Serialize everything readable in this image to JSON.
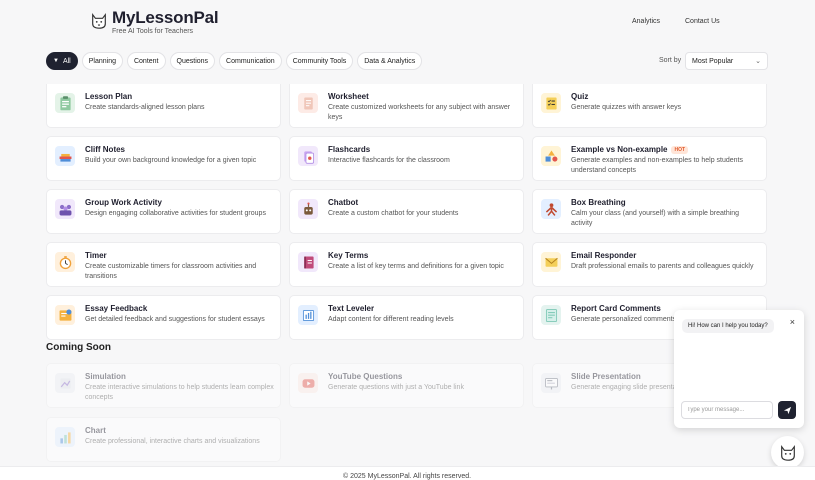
{
  "header": {
    "brand": "MyLessonPal",
    "tagline": "Free AI Tools for Teachers",
    "logo_icon": "cat-face-icon",
    "nav": {
      "analytics": "Analytics",
      "contact": "Contact Us"
    }
  },
  "filters": [
    "All",
    "Planning",
    "Content",
    "Questions",
    "Communication",
    "Community Tools",
    "Data & Analytics"
  ],
  "sort": {
    "label": "Sort by",
    "value": "Most Popular"
  },
  "tools": [
    {
      "title": "Lesson Plan",
      "desc": "Create standards-aligned lesson plans",
      "icon": "clipboard-icon",
      "color": "#e4f3e8"
    },
    {
      "title": "Worksheet",
      "desc": "Create customized worksheets for any subject with answer keys",
      "icon": "worksheet-icon",
      "color": "#fdebe6"
    },
    {
      "title": "Quiz",
      "desc": "Generate quizzes with answer keys",
      "icon": "quiz-icon",
      "color": "#fff4d6"
    },
    {
      "title": "Cliff Notes",
      "desc": "Build your own background knowledge for a given topic",
      "icon": "books-icon",
      "color": "#e3efff"
    },
    {
      "title": "Flashcards",
      "desc": "Interactive flashcards for the classroom",
      "icon": "flashcards-icon",
      "color": "#f1e8fb"
    },
    {
      "title": "Example vs Non-example",
      "badge": "HOT",
      "desc": "Generate examples and non-examples to help students understand concepts",
      "icon": "shapes-icon",
      "color": "#fff4d6"
    },
    {
      "title": "Group Work Activity",
      "desc": "Design engaging collaborative activities for student groups",
      "icon": "group-icon",
      "color": "#f1e8fb"
    },
    {
      "title": "Chatbot",
      "desc": "Create a custom chatbot for your students",
      "icon": "robot-icon",
      "color": "#f1e8fb"
    },
    {
      "title": "Box Breathing",
      "desc": "Calm your class (and yourself) with a simple breathing activity",
      "icon": "breathing-icon",
      "color": "#e3efff"
    },
    {
      "title": "Timer",
      "desc": "Create customizable timers for classroom activities and transitions",
      "icon": "timer-icon",
      "color": "#fff0dc"
    },
    {
      "title": "Key Terms",
      "desc": "Create a list of key terms and definitions for a given topic",
      "icon": "notebook-icon",
      "color": "#f1e8fb"
    },
    {
      "title": "Email Responder",
      "desc": "Draft professional emails to parents and colleagues quickly",
      "icon": "envelope-icon",
      "color": "#fff4d6"
    },
    {
      "title": "Essay Feedback",
      "desc": "Get detailed feedback and suggestions for student essays",
      "icon": "essay-icon",
      "color": "#fff0dc"
    },
    {
      "title": "Text Leveler",
      "desc": "Adapt content for different reading levels",
      "icon": "levels-icon",
      "color": "#e3efff"
    },
    {
      "title": "Report Card Comments",
      "desc": "Generate personalized comments",
      "icon": "report-card-icon",
      "color": "#e4f3ef"
    }
  ],
  "coming_soon": {
    "heading": "Coming Soon",
    "tools": [
      {
        "title": "Simulation",
        "desc": "Create interactive simulations to help students learn complex concepts",
        "icon": "simulation-icon",
        "color": "#eef0f4"
      },
      {
        "title": "YouTube Questions",
        "desc": "Generate questions with just a YouTube link",
        "icon": "youtube-icon",
        "color": "#fdebe6"
      },
      {
        "title": "Slide Presentation",
        "desc": "Generate engaging slide presentations",
        "icon": "slides-icon",
        "color": "#eef0f4"
      },
      {
        "title": "Chart",
        "desc": "Create professional, interactive charts and visualizations",
        "icon": "chart-icon",
        "color": "#e3efff"
      }
    ]
  },
  "chat": {
    "greeting": "Hi! How can I help you today?",
    "placeholder": "Type your message...",
    "close_label": "×"
  },
  "footer": {
    "text": "© 2025 MyLessonPal. All rights reserved."
  },
  "colors": {
    "primary": "#1f2230",
    "hot": "#e0592a",
    "background": "#f7f7f8"
  }
}
